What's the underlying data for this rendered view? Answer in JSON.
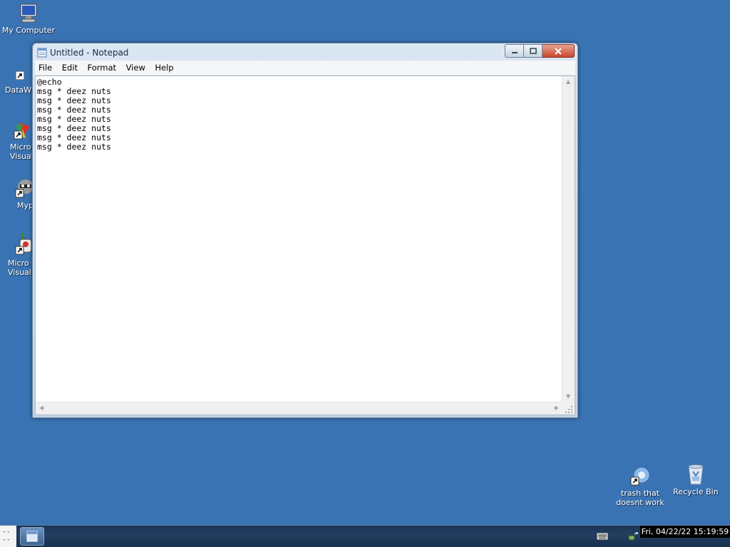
{
  "desktop": {
    "icons_left": [
      {
        "name": "my-computer",
        "label": "My Computer"
      },
      {
        "name": "dataw-shortcut",
        "label": "DataWi"
      },
      {
        "name": "micro-visual-1",
        "label1": "Micro",
        "label2": "Visual"
      },
      {
        "name": "myp-shortcut",
        "label": "Myp"
      },
      {
        "name": "micro-visual-2",
        "label1": "Micro",
        "label2": "Visual"
      }
    ],
    "icons_right": [
      {
        "name": "trash-shortcut",
        "label1": "trash that",
        "label2": "doesnt work"
      },
      {
        "name": "recycle-bin",
        "label": "Recycle Bin"
      }
    ]
  },
  "notepad": {
    "title": "Untitled - Notepad",
    "menu": [
      "File",
      "Edit",
      "Format",
      "View",
      "Help"
    ],
    "content": "@echo\nmsg * deez nuts\nmsg * deez nuts\nmsg * deez nuts\nmsg * deez nuts\nmsg * deez nuts\nmsg * deez nuts\nmsg * deez nuts"
  },
  "taskbar": {
    "start_lines": [
      "- -",
      "- -"
    ],
    "clock": "Fri, 04/22/22 15:19:59"
  },
  "colors": {
    "desktop_bg": "#3a73b3",
    "close_button": "#c7462c"
  },
  "icons": [
    "computer-icon",
    "shortcut-arrow-icon",
    "notepad-icon",
    "minimize-icon",
    "maximize-icon",
    "close-icon",
    "keyboard-icon",
    "network-icon",
    "recycle-bin-icon"
  ]
}
